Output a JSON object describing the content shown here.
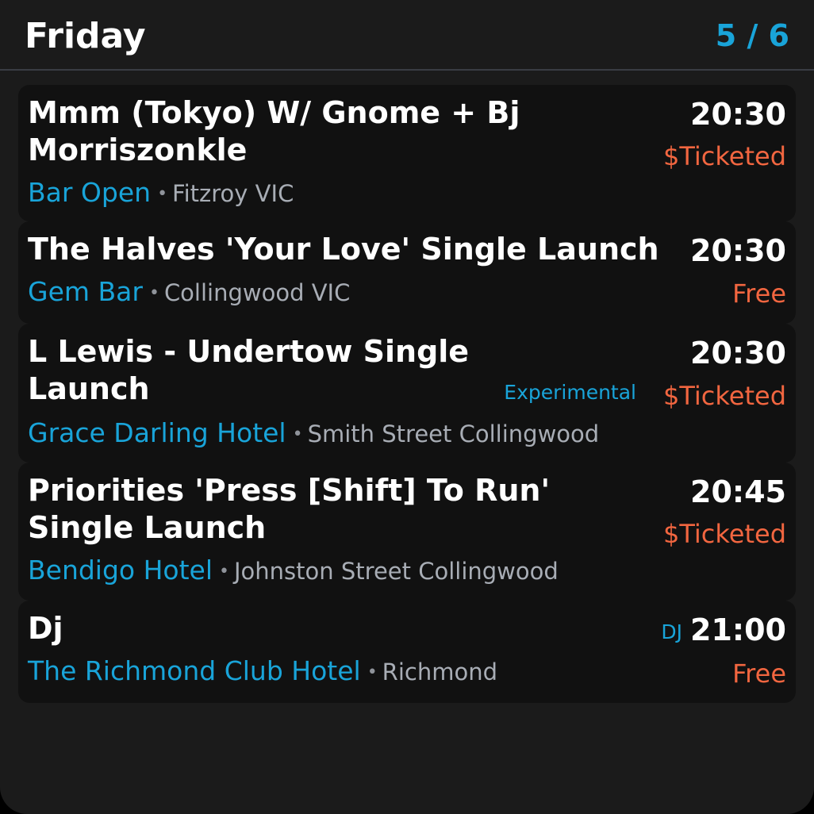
{
  "header": {
    "day": "Friday",
    "pager": "5 / 6"
  },
  "events": [
    {
      "title_lines": [
        "Mmm (Tokyo) W/ Gnome + Bj",
        "Morriszonkle"
      ],
      "time": "20:30",
      "price": "$Ticketed",
      "genre": "",
      "venue": "Bar Open",
      "location": "Fitzroy VIC"
    },
    {
      "title_lines": [
        "The Halves 'Your Love' Single Launch"
      ],
      "time": "20:30",
      "price": "Free",
      "genre": "",
      "venue": "Gem Bar",
      "location": "Collingwood VIC"
    },
    {
      "title_lines": [
        "L Lewis - Undertow Single",
        "Launch"
      ],
      "time": "20:30",
      "price": "$Ticketed",
      "genre": "Experimental",
      "venue": "Grace Darling Hotel",
      "location": "Smith Street Collingwood"
    },
    {
      "title_lines": [
        "Priorities 'Press [Shift] To Run'",
        "Single Launch"
      ],
      "time": "20:45",
      "price": "$Ticketed",
      "genre": "",
      "venue": "Bendigo Hotel",
      "location": "Johnston Street Collingwood"
    },
    {
      "title_lines": [
        "Dj"
      ],
      "time": "21:00",
      "price": "Free",
      "genre": "DJ",
      "venue": "The Richmond Club Hotel",
      "location": "Richmond"
    }
  ],
  "separator": "•",
  "colors": {
    "background": "#1b1b1b",
    "card": "#111111",
    "accent": "#19a4d9",
    "price": "#f26640",
    "muted": "#a8adb5"
  }
}
